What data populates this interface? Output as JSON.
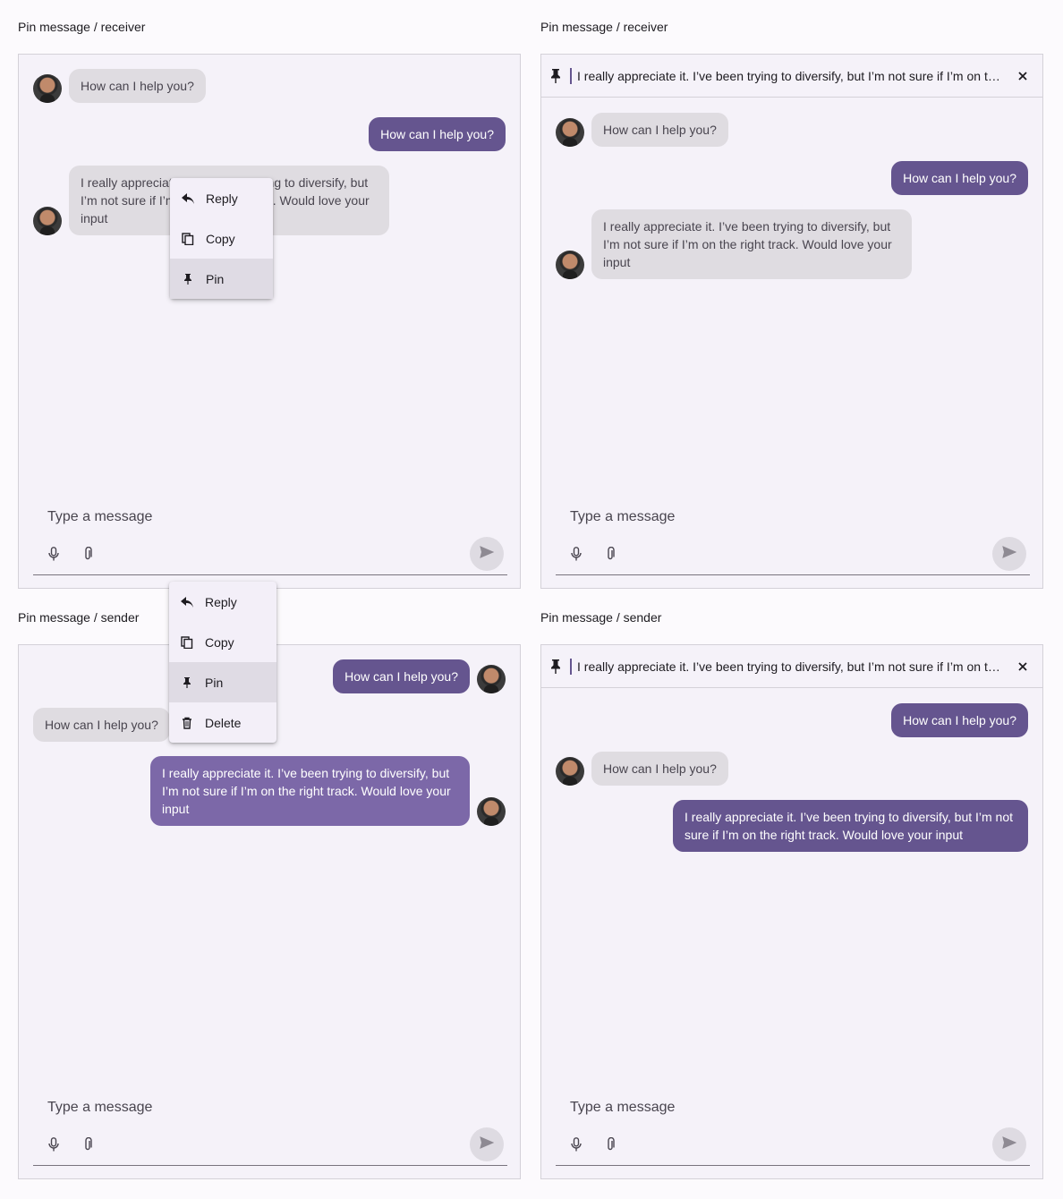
{
  "panels": [
    {
      "caption": "Pin message / receiver",
      "messages": [
        "How can I help you?",
        "How can I help you?",
        "I really appreciate it. I’ve been trying to diversify, but I’m not sure if I’m on the right track. Would love your input"
      ],
      "menu": [
        "Reply",
        "Copy",
        "Pin"
      ],
      "composer_placeholder": "Type a message"
    },
    {
      "caption": "Pin message / receiver",
      "pinned_text": "I really appreciate it. I’ve been trying to diversify, but I’m not sure if I’m on the right track. Would love your input",
      "messages": [
        "How can I help you?",
        "How can I help you?",
        "I really appreciate it. I’ve been trying to diversify, but I’m not sure if I’m on the right track. Would love your input"
      ],
      "composer_placeholder": "Type a message"
    },
    {
      "caption": "Pin message / sender",
      "messages": [
        "How can I help you?",
        "How can I help you?",
        "I really appreciate it. I’ve been trying to diversify, but I’m not sure if I’m on the right track. Would love your input"
      ],
      "menu": [
        "Reply",
        "Copy",
        "Pin",
        "Delete"
      ],
      "composer_placeholder": "Type a message"
    },
    {
      "caption": "Pin message / sender",
      "pinned_text": "I really appreciate it. I’ve been trying to diversify, but I’m not sure if I’m on the right track. Would love your input",
      "messages": [
        "How can I help you?",
        "How can I help you?",
        "I really appreciate it. I’ve been trying to diversify, but I’m not sure if I’m on the right track. Would love your input"
      ],
      "composer_placeholder": "Type a message"
    }
  ],
  "icons": {
    "reply": "reply-icon",
    "copy": "copy-icon",
    "pin": "pin-icon",
    "delete": "trash-icon",
    "mic": "microphone-icon",
    "attach": "paperclip-icon",
    "send": "send-icon",
    "close": "close-icon"
  },
  "colors": {
    "outgoing_bubble": "#65558f",
    "outgoing_bubble_selected": "#7c68a8",
    "incoming_bubble": "#dfdce1",
    "panel_bg": "#f5f2f9"
  }
}
